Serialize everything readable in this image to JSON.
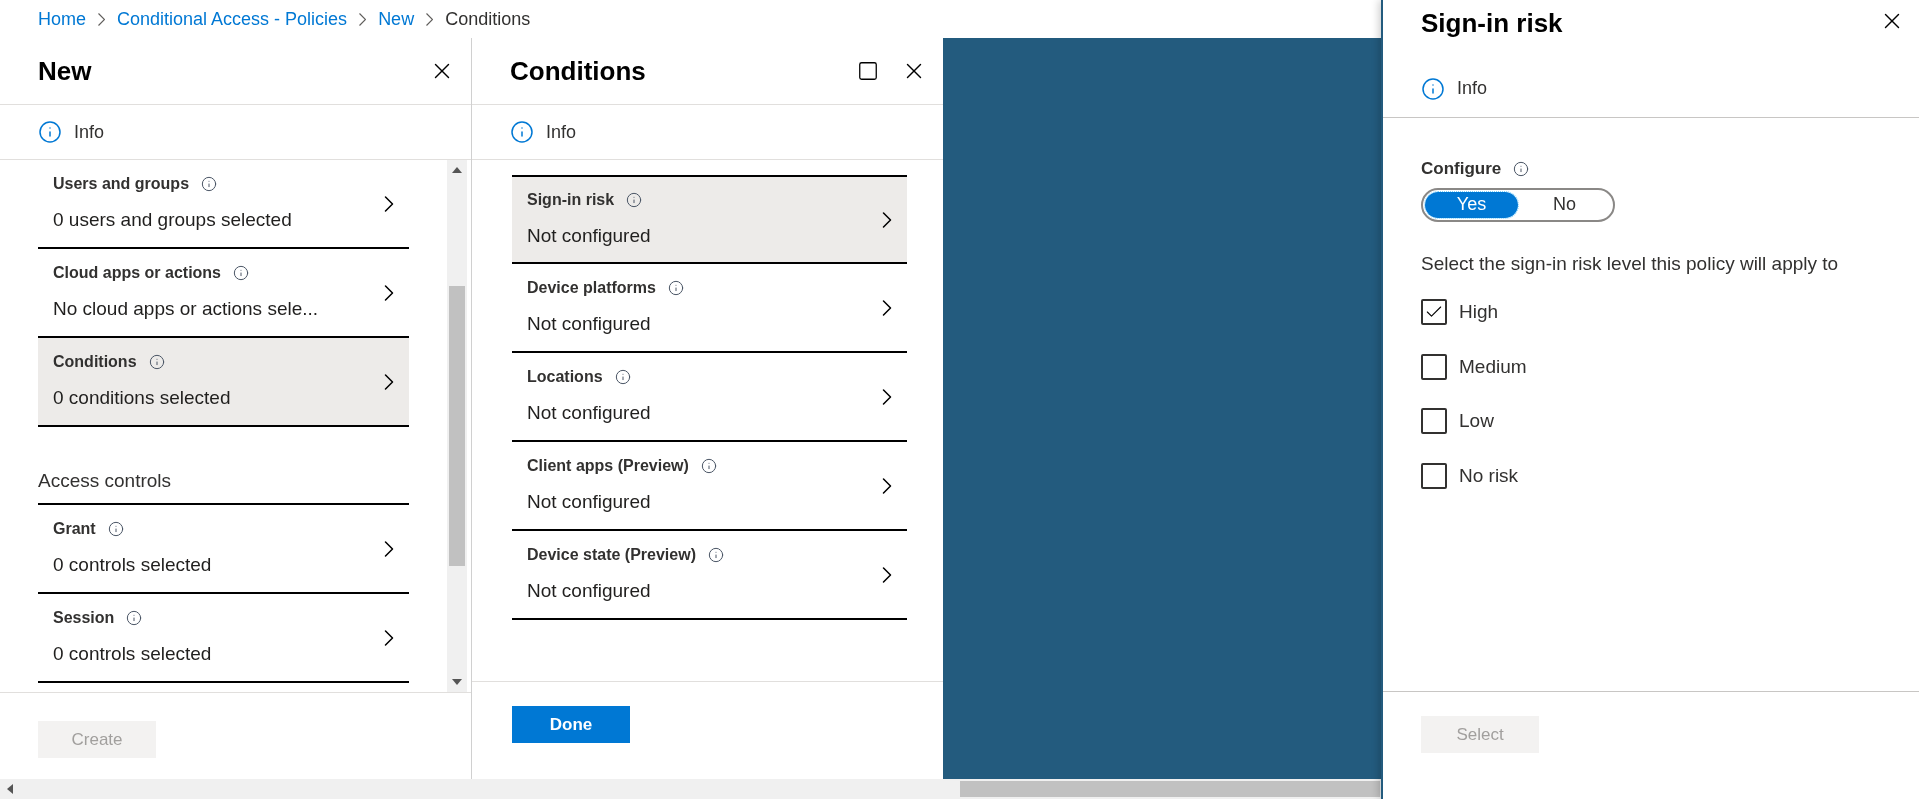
{
  "breadcrumb": [
    "Home",
    "Conditional Access - Policies",
    "New",
    "Conditions"
  ],
  "new_panel": {
    "title": "New",
    "info": "Info",
    "items": [
      {
        "kind": "item",
        "label": "Users and groups",
        "summary": "0 users and groups selected",
        "selected": false
      },
      {
        "kind": "item",
        "label": "Cloud apps or actions",
        "summary": "No cloud apps or actions sele...",
        "selected": false
      },
      {
        "kind": "item",
        "label": "Conditions",
        "summary": "0 conditions selected",
        "selected": true
      },
      {
        "kind": "heading",
        "label": "Access controls"
      },
      {
        "kind": "item",
        "label": "Grant",
        "summary": "0 controls selected",
        "selected": false
      },
      {
        "kind": "item",
        "label": "Session",
        "summary": "0 controls selected",
        "selected": false
      }
    ],
    "button": {
      "label": "Create",
      "disabled": true
    }
  },
  "conditions_panel": {
    "title": "Conditions",
    "info": "Info",
    "items": [
      {
        "label": "Sign-in risk",
        "summary": "Not configured",
        "selected": true
      },
      {
        "label": "Device platforms",
        "summary": "Not configured",
        "selected": false
      },
      {
        "label": "Locations",
        "summary": "Not configured",
        "selected": false
      },
      {
        "label": "Client apps (Preview)",
        "summary": "Not configured",
        "selected": false
      },
      {
        "label": "Device state (Preview)",
        "summary": "Not configured",
        "selected": false
      }
    ],
    "button": {
      "label": "Done",
      "disabled": false
    }
  },
  "sign_in_risk_panel": {
    "title": "Sign-in risk",
    "info": "Info",
    "configure_label": "Configure",
    "toggle": [
      {
        "label": "Yes",
        "selected": true
      },
      {
        "label": "No",
        "selected": false
      }
    ],
    "prompt": "Select the sign-in risk level this policy will apply to",
    "levels": [
      {
        "label": "High",
        "checked": true
      },
      {
        "label": "Medium",
        "checked": false
      },
      {
        "label": "Low",
        "checked": false
      },
      {
        "label": "No risk",
        "checked": false
      }
    ],
    "button": {
      "label": "Select",
      "disabled": true
    }
  }
}
